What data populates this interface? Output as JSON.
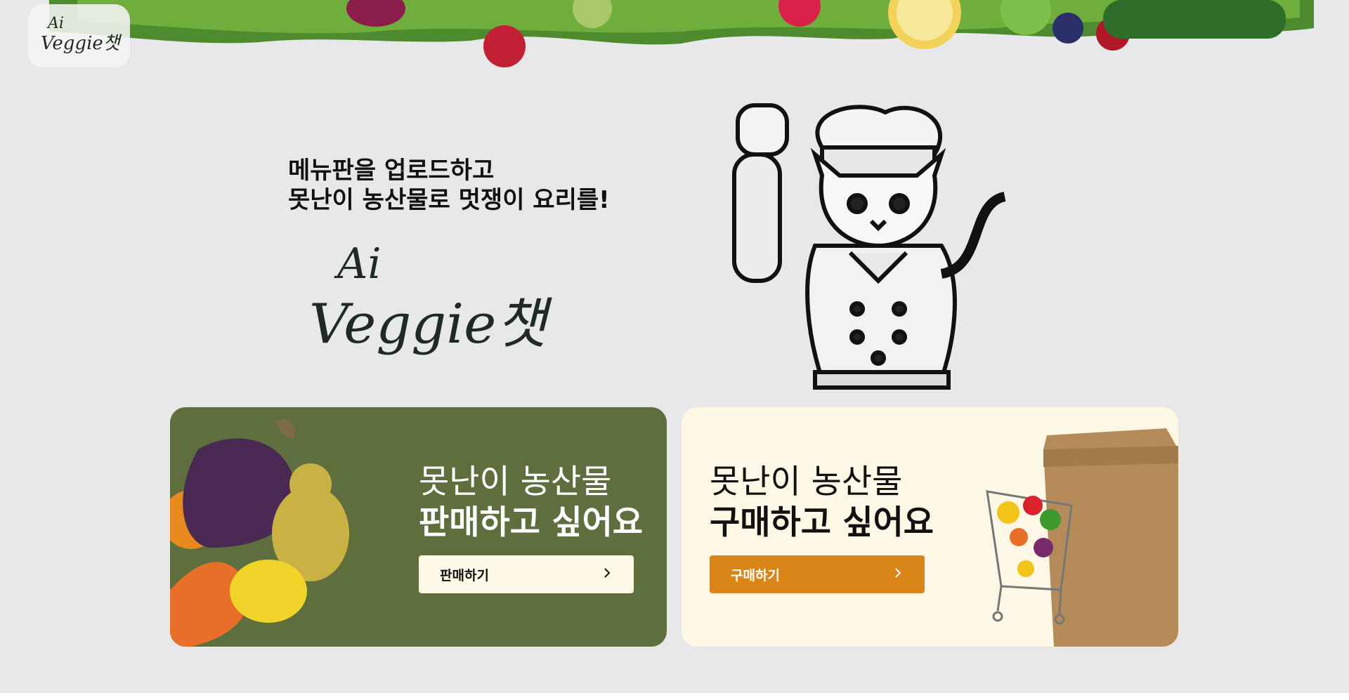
{
  "header": {
    "logo_line1": "Ai",
    "logo_line2": "Veggie챗",
    "banner_icon": "vegetable-border-image"
  },
  "hero": {
    "heading_line1": "메뉴판을 업로드하고",
    "heading_line2": "못난이 농산물로 멋쟁이 요리를!",
    "logo_line1": "Ai",
    "logo_line2": "Veggie챗",
    "mascot_icon": "chef-cat-illustration"
  },
  "cards": {
    "sell": {
      "title_line1": "못난이 농산물",
      "title_line2": "판매하고 싶어요",
      "button_label": "판매하기",
      "art_icon": "ugly-produce-image",
      "bg_color": "#5e6e3d",
      "button_color": "#fdf8e6"
    },
    "buy": {
      "title_line1": "못난이 농산물",
      "title_line2": "구매하고 싶어요",
      "button_label": "구매하기",
      "art_icon": "shopping-cart-bag-image",
      "bg_color": "#fdf8e6",
      "button_color": "#d98518"
    }
  },
  "colors": {
    "page_bg": "#e8e8ea",
    "accent_orange": "#d98518",
    "accent_green": "#5e6e3d"
  }
}
